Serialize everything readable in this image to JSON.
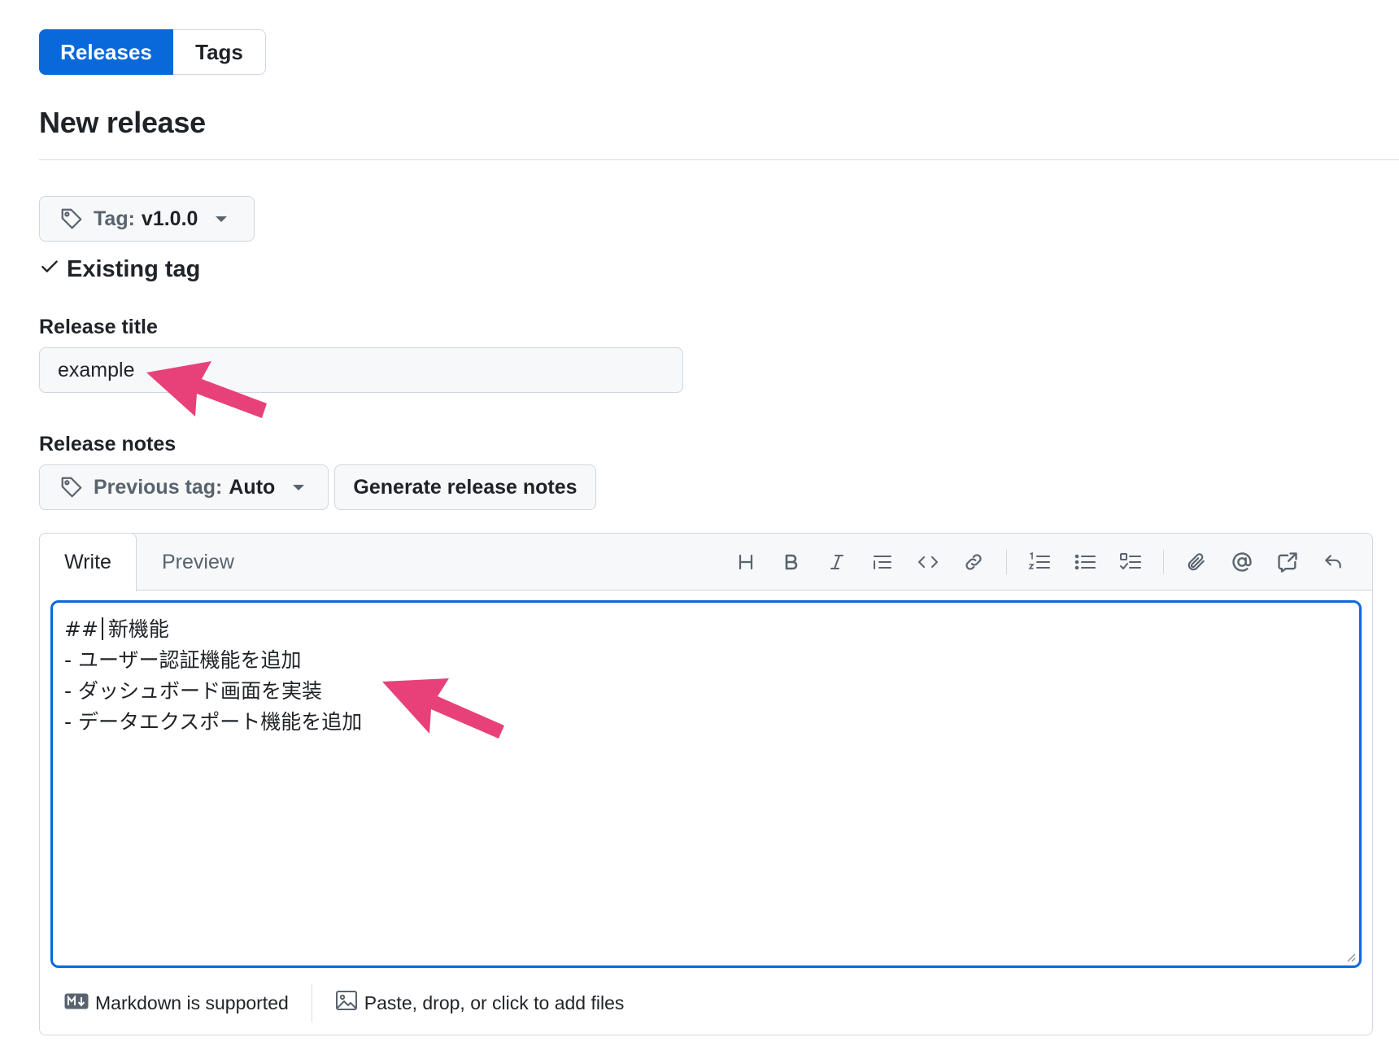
{
  "tabs": {
    "releases": "Releases",
    "tags": "Tags"
  },
  "page_title": "New release",
  "tag_picker": {
    "prefix": "Tag:",
    "value": "v1.0.0",
    "status": "Existing tag"
  },
  "release_title": {
    "label": "Release title",
    "value": "example"
  },
  "release_notes": {
    "label": "Release notes",
    "previous_tag_prefix": "Previous tag:",
    "previous_tag_value": "Auto",
    "generate_button": "Generate release notes"
  },
  "editor": {
    "tab_write": "Write",
    "tab_preview": "Preview",
    "toolbar_icons": [
      "heading-icon",
      "bold-icon",
      "italic-icon",
      "quote-icon",
      "code-icon",
      "link-icon",
      "numbered-list-icon",
      "bullet-list-icon",
      "task-list-icon",
      "attach-icon",
      "mention-icon",
      "reference-icon",
      "undo-icon"
    ],
    "content_line1_prefix": "##",
    "content_line1_text": "新機能",
    "content_line2": "- ユーザー認証機能を追加",
    "content_line3": "- ダッシュボード画面を実装",
    "content_line4": "- データエクスポート機能を追加",
    "markdown_note": "Markdown is supported",
    "files_note": "Paste, drop, or click to add files"
  },
  "colors": {
    "primary": "#0969da",
    "annotation_arrow": "#e8417a"
  }
}
